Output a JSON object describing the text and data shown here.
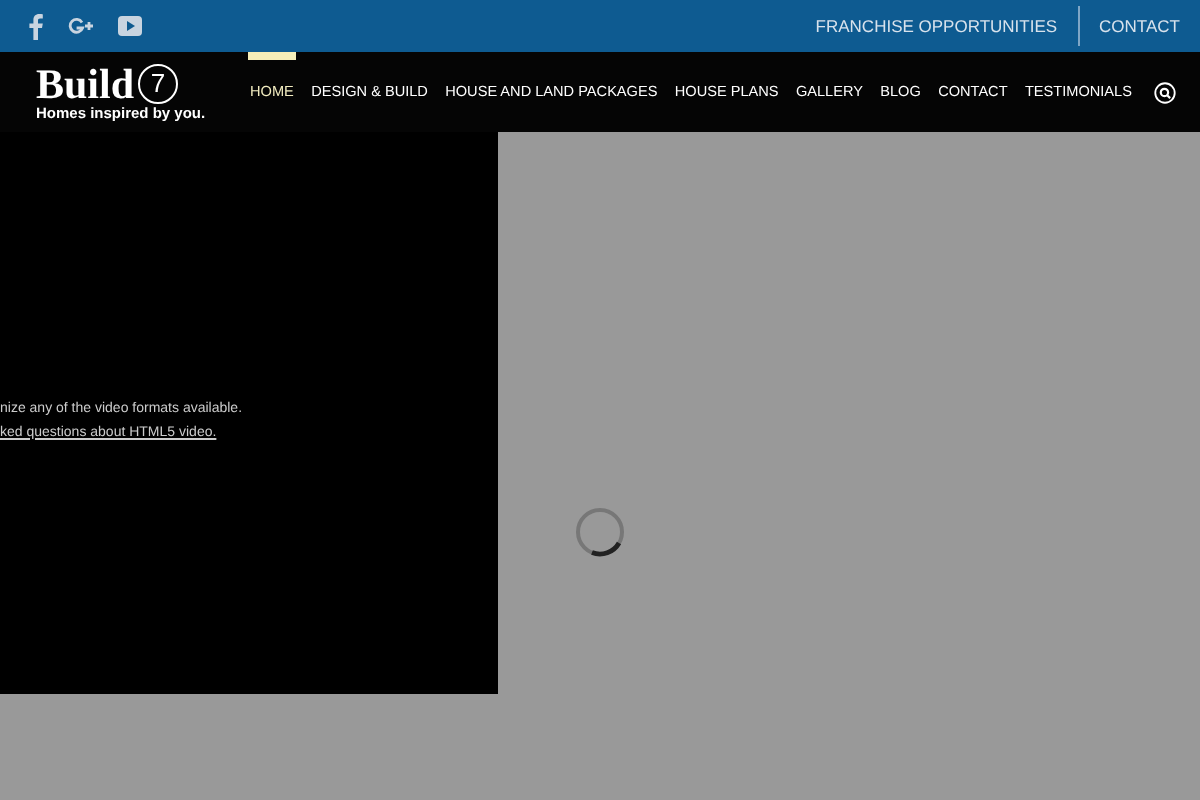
{
  "top_bar": {
    "social": [
      {
        "kind": "facebook"
      },
      {
        "kind": "googleplus"
      },
      {
        "kind": "youtube"
      }
    ],
    "links": [
      "FRANCHISE OPPORTUNITIES",
      "CONTACT"
    ]
  },
  "logo": {
    "name": "Build",
    "mark": "7",
    "tagline": "Homes inspired by you."
  },
  "nav": [
    {
      "label": "HOME",
      "selected": true
    },
    {
      "label": "DESIGN & BUILD",
      "selected": false
    },
    {
      "label": "HOUSE AND LAND PACKAGES",
      "selected": false
    },
    {
      "label": "HOUSE PLANS",
      "selected": false
    },
    {
      "label": "GALLERY",
      "selected": false
    },
    {
      "label": "BLOG",
      "selected": false
    },
    {
      "label": "CONTACT",
      "selected": false
    },
    {
      "label": "TESTIMONIALS",
      "selected": false
    }
  ],
  "video": {
    "message": "nize any of the video formats available.",
    "link": "ked questions about HTML5 video."
  }
}
